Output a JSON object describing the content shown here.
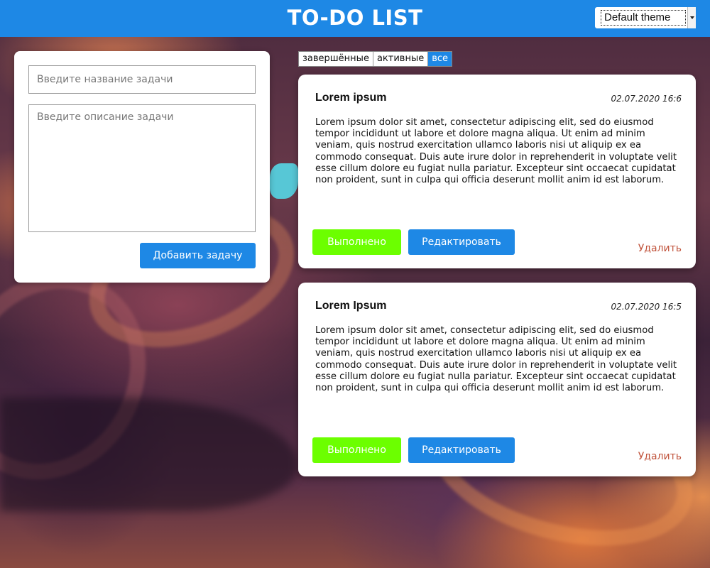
{
  "header": {
    "title": "TO-DO LIST",
    "theme_select": {
      "selected": "Default theme",
      "icon": "chevron-down-icon"
    }
  },
  "form": {
    "title_placeholder": "Введите название задачи",
    "title_value": "",
    "description_placeholder": "Введите описание задачи",
    "description_value": "",
    "add_button": "Добавить задачу"
  },
  "filters": {
    "items": [
      {
        "label": "завершённые",
        "active": false
      },
      {
        "label": "активные",
        "active": false
      },
      {
        "label": "все",
        "active": true
      }
    ]
  },
  "tasks": [
    {
      "title": "Lorem ipsum",
      "date": "02.07.2020 16:6",
      "text": "Lorem ipsum dolor sit amet, consectetur adipiscing elit, sed do eiusmod tempor incididunt ut labore et dolore magna aliqua. Ut enim ad minim veniam, quis nostrud exercitation ullamco laboris nisi ut aliquip ex ea commodo consequat. Duis aute irure dolor in reprehenderit in voluptate velit esse cillum dolore eu fugiat nulla pariatur. Excepteur sint occaecat cupidatat non proident, sunt in culpa qui officia deserunt mollit anim id est laborum.",
      "done_label": "Выполнено",
      "edit_label": "Редактировать",
      "delete_label": "Удалить"
    },
    {
      "title": "Lorem Ipsum",
      "date": "02.07.2020 16:5",
      "text": "Lorem ipsum dolor sit amet, consectetur adipiscing elit, sed do eiusmod tempor incididunt ut labore et dolore magna aliqua. Ut enim ad minim veniam, quis nostrud exercitation ullamco laboris nisi ut aliquip ex ea commodo consequat. Duis aute irure dolor in reprehenderit in voluptate velit esse cillum dolore eu fugiat nulla pariatur. Excepteur sint occaecat cupidatat non proident, sunt in culpa qui officia deserunt mollit anim id est laborum.",
      "done_label": "Выполнено",
      "edit_label": "Редактировать",
      "delete_label": "Удалить"
    }
  ],
  "colors": {
    "accent": "#1e88e5",
    "done_button": "#6cff00",
    "delete_link": "#c0523a"
  }
}
